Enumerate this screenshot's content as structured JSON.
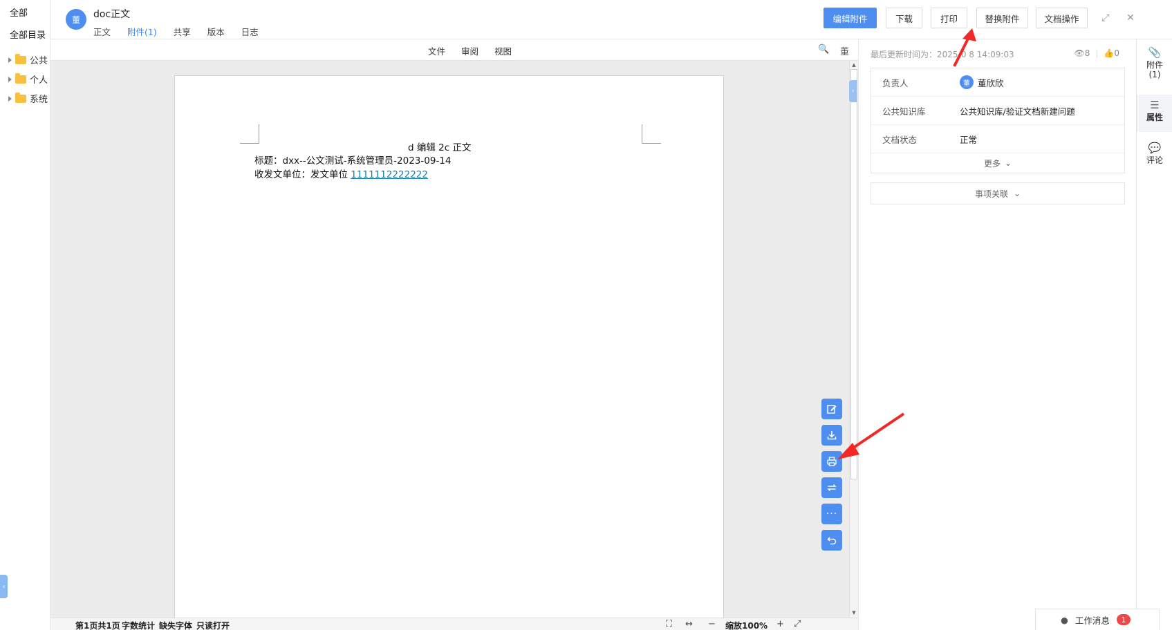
{
  "left_sidebar": {
    "top_link": "全部",
    "catalog": "全部目录",
    "tree": [
      {
        "label": "公共"
      },
      {
        "label": "个人"
      },
      {
        "label": "系统"
      }
    ]
  },
  "header": {
    "avatar_text": "董",
    "title": "doc正文",
    "tabs": [
      {
        "label": "正文"
      },
      {
        "label": "附件(1)",
        "active": true
      },
      {
        "label": "共享"
      },
      {
        "label": "版本"
      },
      {
        "label": "日志"
      }
    ],
    "buttons": {
      "edit_attachment": "编辑附件",
      "download": "下载",
      "print": "打印",
      "replace_attachment": "替换附件",
      "doc_ops": "文档操作"
    }
  },
  "doc_toolbar": {
    "menus": [
      "文件",
      "审阅",
      "视图"
    ],
    "user_badge": "董"
  },
  "document": {
    "heading": "d 编辑 2c 正文",
    "line2": "标题：dxx--公文测试-系统管理员-2023-09-14",
    "line3_prefix": "收发文单位：发文单位 ",
    "line3_link": "1111112222222"
  },
  "status_bar": {
    "page": "第1页共1页",
    "word_count": "字数统计",
    "missing_fonts": "缺失字体",
    "readonly": "只读打开",
    "zoom": "缩放100%"
  },
  "right_panel": {
    "last_update": "最后更新时间为：2025-0  8 14:09:03",
    "views": "8",
    "likes": "0",
    "props": [
      {
        "key": "负责人",
        "value": "董欣欣",
        "avatar": "董"
      },
      {
        "key": "公共知识库",
        "value": "公共知识库/验证文档新建问题"
      },
      {
        "key": "文档状态",
        "value": "正常"
      }
    ],
    "more": "更多",
    "related": "事项关联"
  },
  "rail": {
    "attachment": "附件",
    "attachment_count": "(1)",
    "properties": "属性",
    "comments": "评论"
  },
  "message_box": {
    "label": "工作消息",
    "count": "1"
  },
  "colors": {
    "primary": "#4d8ef0",
    "annotation_red": "#f02828",
    "badge_red": "#f04848"
  }
}
